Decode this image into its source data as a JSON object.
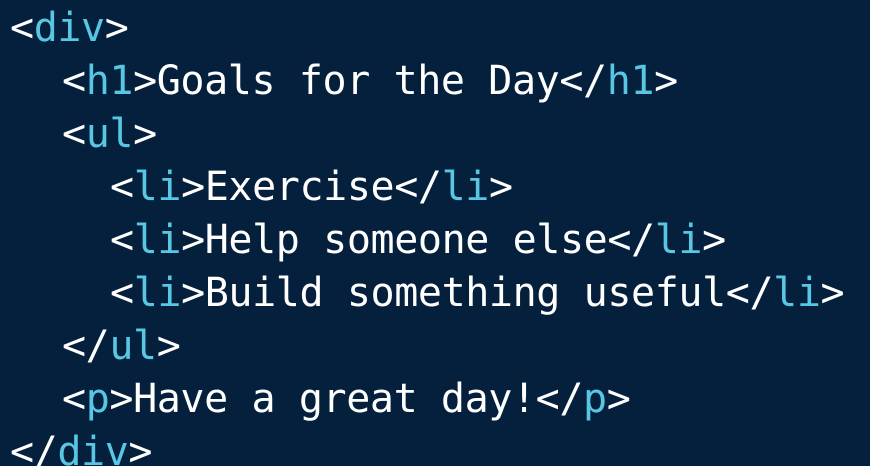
{
  "theme": {
    "background": "#04203c",
    "tag_color": "#57c7e3",
    "text_color": "#ffffff"
  },
  "code": {
    "lines": [
      {
        "indent": 0,
        "open_tag": "div",
        "text": "",
        "close_tag": ""
      },
      {
        "indent": 1,
        "open_tag": "h1",
        "text": "Goals for the Day",
        "close_tag": "h1"
      },
      {
        "indent": 1,
        "open_tag": "ul",
        "text": "",
        "close_tag": ""
      },
      {
        "indent": 2,
        "open_tag": "li",
        "text": "Exercise",
        "close_tag": "li"
      },
      {
        "indent": 2,
        "open_tag": "li",
        "text": "Help someone else",
        "close_tag": "li"
      },
      {
        "indent": 2,
        "open_tag": "li",
        "text": "Build something useful",
        "close_tag": "li"
      },
      {
        "indent": 1,
        "open_tag": "",
        "text": "",
        "close_tag": "ul"
      },
      {
        "indent": 1,
        "open_tag": "p",
        "text": "Have a great day!",
        "close_tag": "p"
      },
      {
        "indent": 0,
        "open_tag": "",
        "text": "",
        "close_tag": "div"
      }
    ]
  }
}
